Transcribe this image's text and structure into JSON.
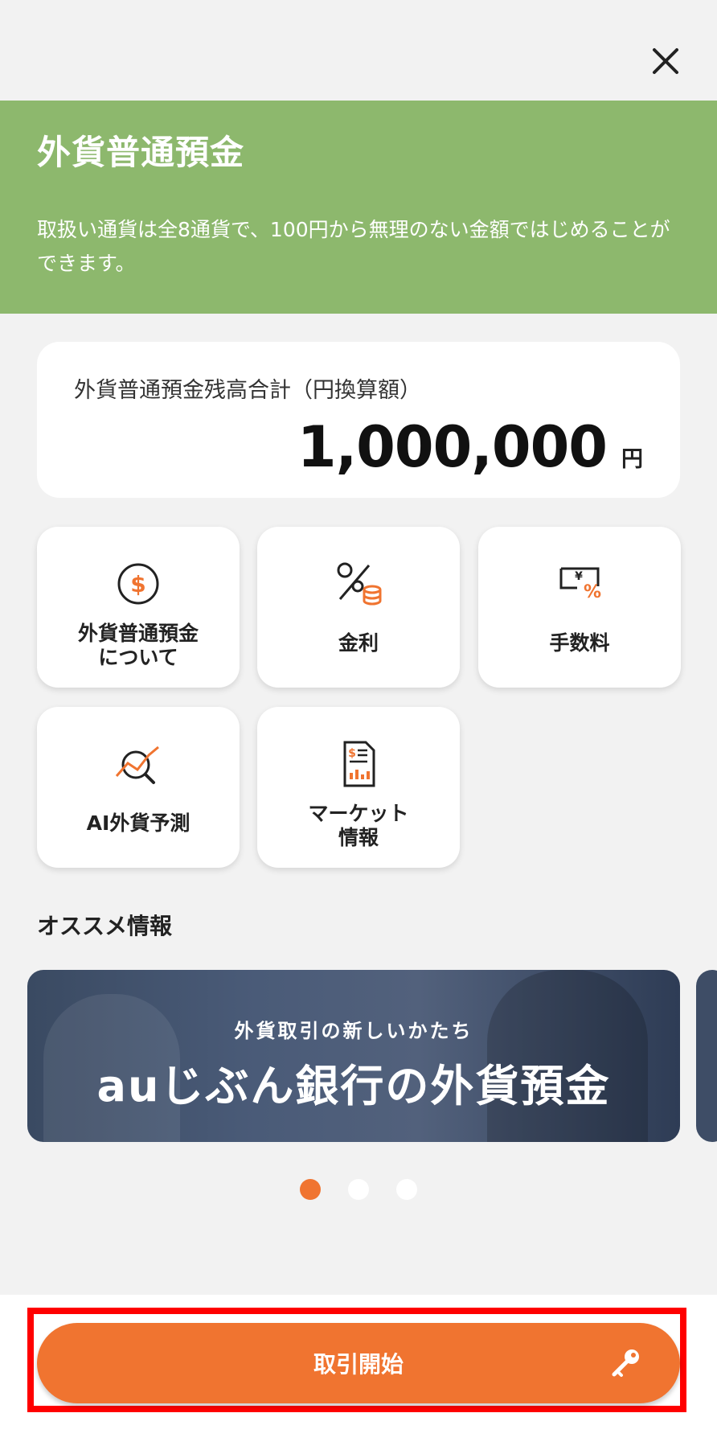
{
  "header": {
    "close_icon": "close-icon"
  },
  "hero": {
    "title": "外貨普通預金",
    "description": "取扱い通貨は全8通貨で、100円から無理のない金額ではじめることができます。",
    "bg_color": "#8db86d"
  },
  "balance": {
    "label": "外貨普通預金残高合計（円換算額）",
    "value": "1,000,000",
    "unit": "円"
  },
  "menu": {
    "items": [
      {
        "label_line1": "外貨普通預金",
        "label_line2": "について",
        "icon": "dollar-circle-icon"
      },
      {
        "label": "金利",
        "icon": "interest-rate-icon"
      },
      {
        "label": "手数料",
        "icon": "fee-icon"
      },
      {
        "label": "AI外貨予測",
        "icon": "ai-forecast-icon"
      },
      {
        "label_line1": "マーケット",
        "label_line2": "情報",
        "icon": "market-report-icon"
      }
    ]
  },
  "recommend": {
    "title": "オススメ情報",
    "banner": {
      "subtitle": "外貨取引の新しいかたち",
      "headline": "auじぶん銀行の外貨預金"
    },
    "pagination": {
      "count": 3,
      "active": 1
    }
  },
  "footer": {
    "start_label": "取引開始",
    "key_icon": "key-icon",
    "accent_color": "#f07430"
  }
}
